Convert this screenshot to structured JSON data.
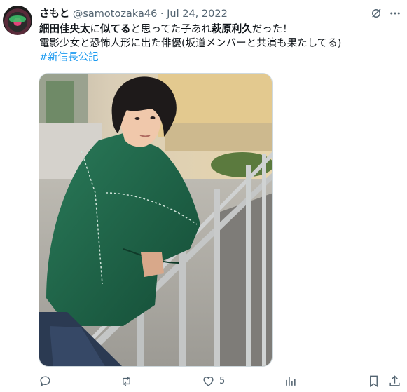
{
  "tweet": {
    "display_name": "さもと",
    "handle": "@samotozaka46",
    "separator": "·",
    "date": "Jul 24, 2022",
    "text_line1": {
      "bold1": "細田佳央太",
      "plain1": "に",
      "bold2": "似てる",
      "plain2": "と思ってた子あれ",
      "bold3": "萩原利久",
      "plain3": "だった！"
    },
    "text_line2": "電影少女と恐怖人形に出た俳優(坂道メンバーと共演も果たしてる)",
    "hashtag": "#新信長公記"
  },
  "actions": {
    "like_count": "5"
  },
  "icons": {
    "avatar": "avatar-image",
    "grok": "grok-icon",
    "more": "more-icon",
    "reply": "reply-icon",
    "retweet": "retweet-icon",
    "like": "heart-icon",
    "views": "views-icon",
    "bookmark": "bookmark-icon",
    "share": "share-icon"
  },
  "colors": {
    "text": "#0f1419",
    "secondary": "#536471",
    "link": "#1d9bf0",
    "jacket": "#1f6b4e"
  }
}
